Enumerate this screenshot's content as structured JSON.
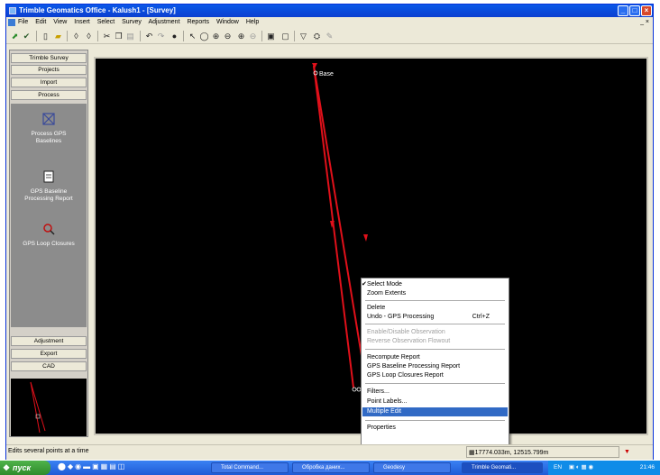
{
  "window": {
    "title": "Trimble Geomatics Office - Kalush1 - [Survey]"
  },
  "menu": {
    "items": [
      "File",
      "Edit",
      "View",
      "Insert",
      "Select",
      "Survey",
      "Adjustment",
      "Reports",
      "Window",
      "Help"
    ],
    "right_controls": "_ ×"
  },
  "sidebar": {
    "top_buttons": [
      "Trimble Survey",
      "Projects",
      "Import",
      "Process"
    ],
    "process_items": [
      {
        "label": "Process GPS Baselines",
        "icon": "process-baselines-icon"
      },
      {
        "label": "GPS Baseline Processing Report",
        "icon": "report-icon"
      },
      {
        "label": "GPS Loop Closures",
        "icon": "loop-closure-icon"
      }
    ],
    "bottom_buttons": [
      "Adjustment",
      "Export",
      "CAD"
    ]
  },
  "canvas": {
    "point_label_base": "Base"
  },
  "context_menu": {
    "items": [
      {
        "label": "Select Mode",
        "checked": true
      },
      {
        "label": "Zoom Extents"
      },
      {
        "label": "Delete"
      },
      {
        "label": "Undo - GPS Processing",
        "shortcut": "Ctrl+Z"
      },
      {
        "label": "Enable/Disable Observation",
        "disabled": true
      },
      {
        "label": "Reverse Observation Flowout",
        "disabled": true
      },
      {
        "label": "Recompute Report"
      },
      {
        "label": "GPS Baseline Processing Report"
      },
      {
        "label": "GPS Loop Closures Report"
      },
      {
        "label": "Filters..."
      },
      {
        "label": "Point Labels..."
      },
      {
        "label": "Multiple Edit",
        "highlighted": true
      },
      {
        "label": "Properties"
      }
    ]
  },
  "status_bar": {
    "hint": "Edits several points at a time",
    "coordinates": "17774.033m, 12515.799m"
  },
  "taskbar": {
    "start_label": "пуск",
    "tasks": [
      "Total Command...",
      "Обробка даних...",
      "Geodesy",
      "Trimble Geomati..."
    ],
    "tray_lang": "EN",
    "clock": "21:46"
  },
  "colors": {
    "line_red": "#e0101a",
    "titlebar_blue": "#0a58e8",
    "highlight_blue": "#316ac5",
    "sidebar_process_gray": "#8c8c8c"
  }
}
